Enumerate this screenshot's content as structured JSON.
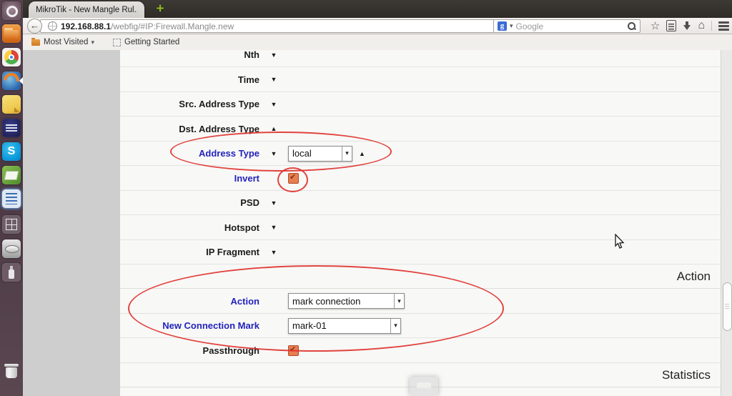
{
  "browser": {
    "tab": {
      "title": "MikroTik - New Mangle Rul...",
      "new_tab_label": "+"
    },
    "nav": {
      "url_domain": "192.168.88.1",
      "url_path": "/webfig/#IP:Firewall.Mangle.new",
      "search_placeholder": "Google",
      "search_engine_icon": "google-favicon"
    },
    "bookmarks_bar": {
      "items": [
        "Most Visited",
        "Getting Started"
      ]
    }
  },
  "launcher": {
    "items": [
      "dash-home",
      "files",
      "chromium",
      "firefox",
      "sticky-notes",
      "eclipse",
      "skype",
      "dictionary",
      "document-viewer",
      "workspace-switcher",
      "hard-disk",
      "usb-drive",
      "trash"
    ]
  },
  "glyphs": {
    "down": "▼",
    "up": "▲"
  },
  "form": {
    "matcher_rows": [
      {
        "label": "Nth",
        "arrow": "▼"
      },
      {
        "label": "Time",
        "arrow": "▼"
      },
      {
        "label": "Src. Address Type",
        "arrow": "▼"
      },
      {
        "label": "Dst. Address Type",
        "arrow": "▲"
      },
      {
        "label": "Address Type",
        "arrow": "▼",
        "value": "local",
        "tail_arrow": "▲",
        "highlighted": true
      },
      {
        "label": "Invert",
        "checked": true,
        "highlighted": true
      },
      {
        "label": "PSD",
        "arrow": "▼"
      },
      {
        "label": "Hotspot",
        "arrow": "▼"
      },
      {
        "label": "IP Fragment",
        "arrow": "▼"
      }
    ],
    "action_section_title": "Action",
    "action_rows": [
      {
        "label": "Action",
        "value": "mark connection",
        "highlighted": true
      },
      {
        "label": "New Connection Mark",
        "value": "mark-01",
        "highlighted": true
      },
      {
        "label": "Passthrough",
        "checked": true
      }
    ],
    "statistics_section_title": "Statistics"
  },
  "colors": {
    "annotation_red": "#de302a",
    "label_blue": "#2323bd",
    "checkbox_orange": "#e77e52",
    "new_tab_green": "#8fb821",
    "launcher_bg": "#4a3844"
  }
}
